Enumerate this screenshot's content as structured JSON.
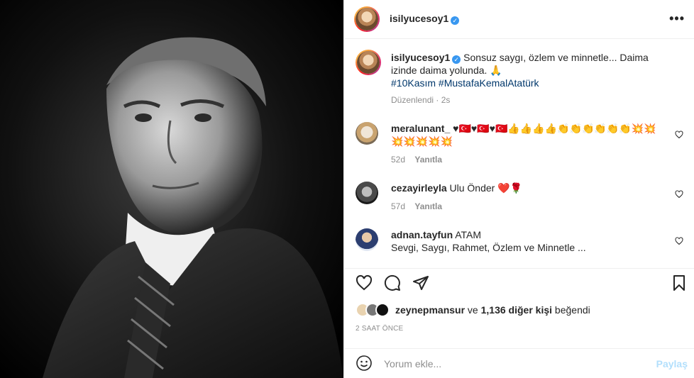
{
  "post": {
    "username": "isilyucesoy1",
    "caption_text": "Sonsuz saygı, özlem ve minnetle... Daima izinde daima yolunda. 🙏",
    "hashtags": "#10Kasım #MustafaKemalAtatürk",
    "edited": "Düzenlendi · 2s",
    "verified_mark": "✓",
    "more_label": "•••"
  },
  "comments": [
    {
      "username": "meralunant_",
      "text": "♥🇹🇷♥🇹🇷♥🇹🇷👍👍👍👍👏👏👏👏👏👏💥💥💥💥💥💥💥",
      "age": "52d",
      "reply_label": "Yanıtla"
    },
    {
      "username": "cezayirleyla",
      "text": "Ulu Önder ❤️🌹",
      "age": "57d",
      "reply_label": "Yanıtla"
    },
    {
      "username": "adnan.tayfun",
      "text": "ATAM",
      "text2": "Sevgi, Saygı, Rahmet, Özlem ve Minnetle ..."
    }
  ],
  "likes": {
    "liker": "zeynepmansur",
    "connector": " ve ",
    "others": "1,136 diğer kişi",
    "suffix": " beğendi"
  },
  "timestamp": "2 SAAT ÖNCE",
  "comment_box": {
    "placeholder": "Yorum ekle...",
    "post_label": "Paylaş"
  },
  "colors": {
    "link": "#00376b",
    "muted": "#8e8e8e",
    "post_disabled": "#b2dffc",
    "verified": "#3897f0"
  },
  "icons": [
    "heart-icon",
    "comment-icon",
    "share-icon",
    "bookmark-icon",
    "emoji-icon",
    "more-icon"
  ]
}
